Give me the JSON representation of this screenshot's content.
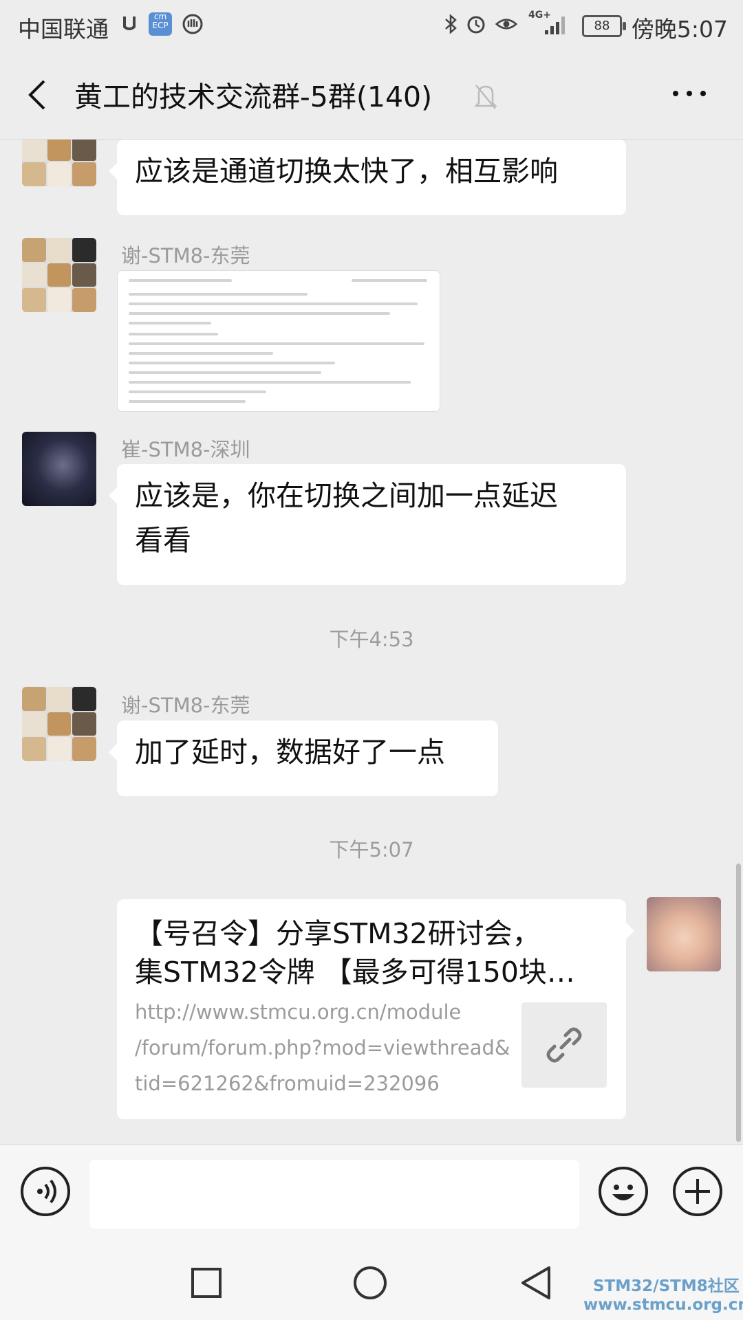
{
  "status_bar": {
    "carrier": "中国联通",
    "app_badge": "cm ECP",
    "network": "4G+",
    "battery": "88",
    "time": "傍晚5:07"
  },
  "header": {
    "title": "黄工的技术交流群-5群(140)"
  },
  "messages": [
    {
      "text": "应该是通道切换太快了，相互影响"
    },
    {
      "sender": "谢-STM8-东莞"
    },
    {
      "sender": "崔-STM8-深圳",
      "text_line1": "应该是，你在切换之间加一点延迟",
      "text_line2": "看看"
    },
    {
      "timestamp": "下午4:53"
    },
    {
      "sender": "谢-STM8-东莞",
      "text": "加了延时，数据好了一点"
    },
    {
      "timestamp": "下午5:07"
    }
  ],
  "link_card": {
    "title_line1": "【号召令】分享STM32研讨会，",
    "title_line2": "集STM32令牌 【最多可得150块…",
    "url_line1": "http://www.stmcu.org.cn/module",
    "url_line2": "/forum/forum.php?mod=viewthread&",
    "url_line3": "tid=621262&fromuid=232096"
  },
  "watermark": {
    "line1": "STM32/STM8社区",
    "line2": "www.stmcu.org.cn"
  },
  "icons": [
    "back-arrow-icon",
    "mute-bell-icon",
    "more-dots-icon",
    "voice-icon",
    "emoji-icon",
    "plus-icon",
    "home-square-icon",
    "circle-icon",
    "back-triangle-icon",
    "link-icon"
  ],
  "colors": {
    "chat_background": "#ededed",
    "bubble": "#ffffff",
    "meta_text": "#9a9a9a"
  }
}
